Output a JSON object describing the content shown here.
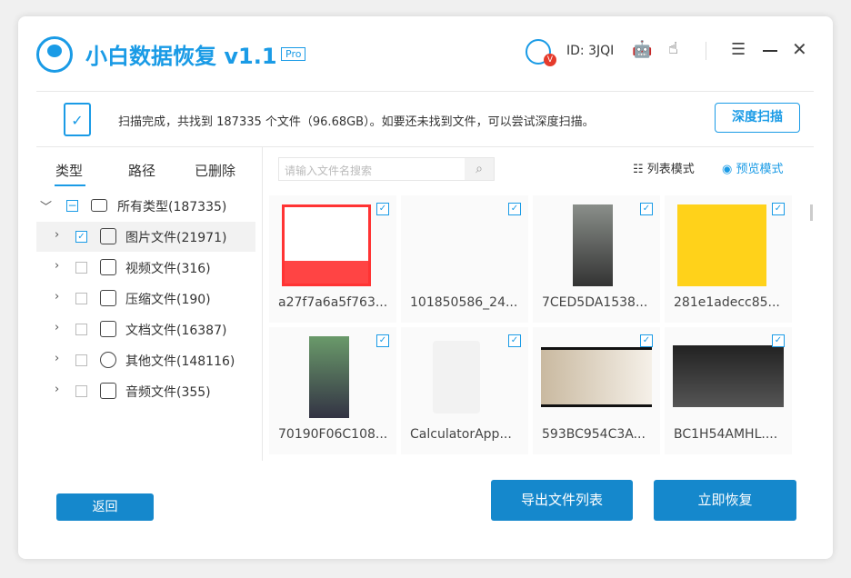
{
  "app": {
    "title": "小白数据恢复 v1.1",
    "badge": "Pro",
    "user_id": "ID: 3JQI",
    "vip": "V"
  },
  "header_icons": [
    "robot-icon",
    "hand-pointer-icon",
    "menu-icon",
    "minimize-icon",
    "close-icon"
  ],
  "info": {
    "message": "扫描完成，共找到 187335 个文件（96.68GB）。如要还未找到文件，可以尝试深度扫描。",
    "deep_scan": "深度扫描"
  },
  "tabs": [
    {
      "label": "类型",
      "active": true
    },
    {
      "label": "路径"
    },
    {
      "label": "已删除"
    }
  ],
  "search": {
    "placeholder": "请输入文件名搜索"
  },
  "view_modes": {
    "list": "列表模式",
    "preview": "预览模式"
  },
  "tree": {
    "root": "所有类型(187335)",
    "items": [
      {
        "label": "图片文件(21971)",
        "checked": true,
        "icon": "image-icon"
      },
      {
        "label": "视频文件(316)",
        "checked": false,
        "icon": "video-icon"
      },
      {
        "label": "压缩文件(190)",
        "checked": false,
        "icon": "zip-icon"
      },
      {
        "label": "文档文件(16387)",
        "checked": false,
        "icon": "document-icon"
      },
      {
        "label": "其他文件(148116)",
        "checked": false,
        "icon": "other-file-icon"
      },
      {
        "label": "音频文件(355)",
        "checked": false,
        "icon": "music-icon"
      }
    ]
  },
  "files": [
    {
      "name": "a27f7a6a5f763...",
      "checked": true
    },
    {
      "name": "101850586_24...",
      "checked": true
    },
    {
      "name": "7CED5DA1538...",
      "checked": true
    },
    {
      "name": "281e1adecc85...",
      "checked": true
    },
    {
      "name": "70190F06C108...",
      "checked": true
    },
    {
      "name": "CalculatorApp...",
      "checked": true
    },
    {
      "name": "593BC954C3A...",
      "checked": true
    },
    {
      "name": "BC1H54AMHL....",
      "checked": true
    }
  ],
  "buttons": {
    "back": "返回",
    "export": "导出文件列表",
    "recover": "立即恢复"
  },
  "colors": {
    "accent": "#1a9be6",
    "button": "#1588cc"
  }
}
